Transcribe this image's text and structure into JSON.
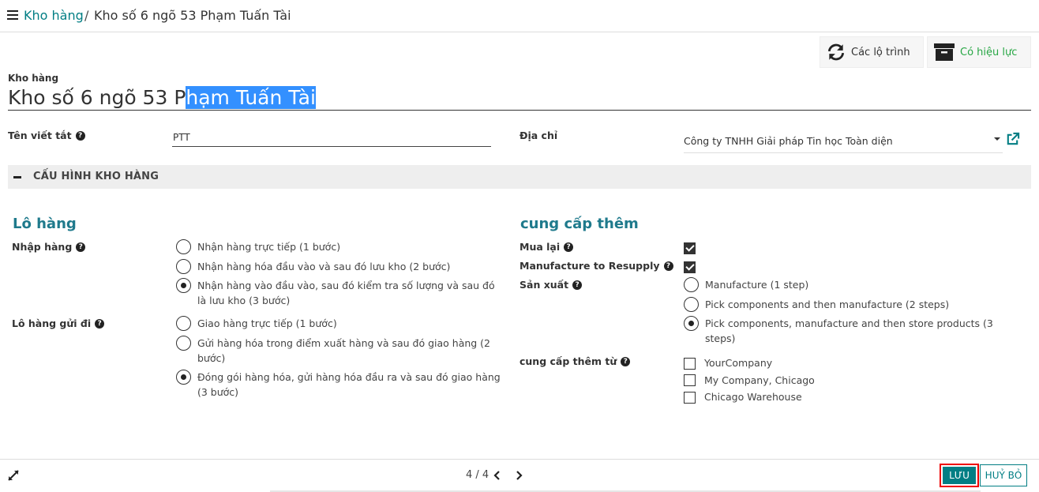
{
  "breadcrumb": {
    "parent": "Kho hàng",
    "separator": "/",
    "current": "Kho số 6 ngõ 53 Phạm Tuấn Tài"
  },
  "smart_buttons": {
    "routes_label": "Các lộ trình",
    "active_label": "Có hiệu lực"
  },
  "title": {
    "label": "Kho hàng",
    "value_plain": "Kho số 6 ngõ 53 P",
    "value_selected": "hạm Tuấn Tài"
  },
  "fields": {
    "short_name_label": "Tên viết tắt",
    "short_name_value": "PTT",
    "address_label": "Địa chỉ",
    "address_value": "Công ty TNHH Giải pháp Tin học Toàn diện",
    "help": "?"
  },
  "section": {
    "title": "CẤU HÌNH KHO HÀNG"
  },
  "shipments": {
    "title": "Lô hàng",
    "incoming_label": "Nhập hàng",
    "incoming_options": [
      "Nhận hàng trực tiếp (1 bước)",
      "Nhận hàng hóa đầu vào và sau đó lưu kho (2 bước)",
      "Nhận hàng vào đầu vào, sau đó kiểm tra số lượng và sau đó",
      "là lưu kho (3 bước)"
    ],
    "outgoing_label": "Lô hàng gửi đi",
    "outgoing_options": [
      "Giao hàng trực tiếp (1 bước)",
      "Gửi hàng hóa trong điểm xuất hàng và sau đó giao hàng (2",
      "bước)",
      "Đóng gói hàng hóa, gửi hàng hóa đầu ra và sau đó giao hàng",
      "(3 bước)"
    ]
  },
  "resupply": {
    "title": "cung cấp thêm",
    "buy_label": "Mua lại",
    "manufacture_resupply_label": "Manufacture to Resupply",
    "manufacture_label": "Sản xuất",
    "manufacture_options": [
      "Manufacture (1 step)",
      "Pick components and then manufacture (2 steps)",
      "Pick components, manufacture and then store products (3",
      "steps)"
    ],
    "resupply_from_label": "cung cấp thêm từ",
    "resupply_from_options": [
      "YourCompany",
      "My Company, Chicago",
      "Chicago Warehouse"
    ]
  },
  "footer": {
    "pager": "4 / 4",
    "save_label": "LƯU",
    "cancel_label": "HUỶ BỎ"
  },
  "colors": {
    "primary": "#017e84",
    "group_title": "#1f7a8c",
    "active": "#28a745",
    "highlight": "#3390ff"
  }
}
